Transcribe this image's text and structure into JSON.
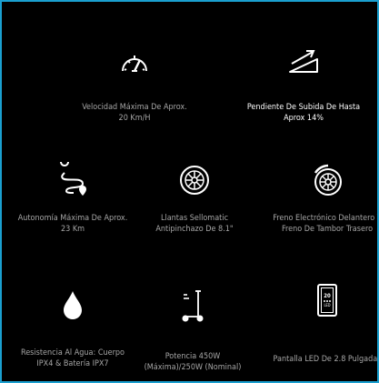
{
  "features": [
    {
      "line1": "Velocidad Máxima De Aprox.",
      "line2": "20 Km/H",
      "icon": "speedometer-icon"
    },
    {
      "line1": "Pendiente De Subida De Hasta",
      "line2": "Aprox 14%",
      "icon": "incline-icon"
    },
    {
      "line1": "Autonomía Máxima De Aprox.",
      "line2": "23 Km",
      "icon": "route-icon"
    },
    {
      "line1": "Llantas Sellomatic",
      "line2": "Antipinchazo De 8.1\"",
      "icon": "tire-icon"
    },
    {
      "line1": "Freno Electrónico Delantero Y",
      "line2": "Freno De Tambor Trasero",
      "icon": "brake-wheel-icon"
    },
    {
      "line1": "Resistencia Al Agua: Cuerpo",
      "line2": "IPX4 & Batería IPX7",
      "icon": "water-drop-icon"
    },
    {
      "line1": "Potencia 450W",
      "line2": "(Máxima)/250W (Nominal)",
      "icon": "scooter-icon"
    },
    {
      "line1": "Pantalla LED De 2.8 Pulgadas",
      "line2": "",
      "icon": "led-display-icon"
    }
  ],
  "display_icon": {
    "top_text": "20",
    "bottom_text": "LED"
  },
  "colors": {
    "frame_border": "#1a9fcf",
    "background": "#000000",
    "muted_text": "#a6a6a6",
    "bright_text": "#ffffff"
  }
}
